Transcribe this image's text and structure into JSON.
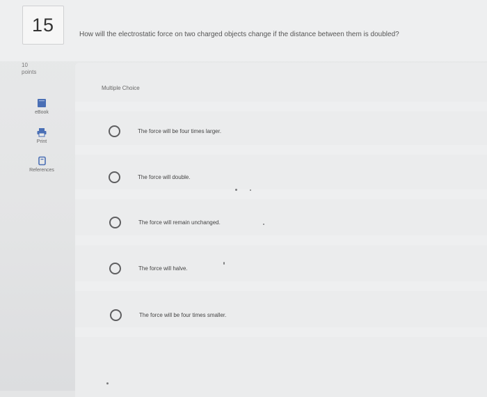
{
  "question": {
    "number": "15",
    "text": "How will the electrostatic force on two charged objects change if the distance between them is doubled?",
    "points_value": "10",
    "points_label": "points",
    "choice_type": "Multiple Choice"
  },
  "tools": {
    "ebook_label": "eBook",
    "print_label": "Print",
    "references_label": "References",
    "ebook_icon": "book-icon",
    "print_icon": "printer-icon",
    "references_icon": "references-icon"
  },
  "options": [
    {
      "label": "The force will be four times larger."
    },
    {
      "label": "The force will double."
    },
    {
      "label": "The force will remain unchanged."
    },
    {
      "label": "The force will halve."
    },
    {
      "label": "The force will be four times smaller."
    }
  ],
  "colors": {
    "accent": "#4a6fb5",
    "radio_border": "#5e5e60"
  }
}
